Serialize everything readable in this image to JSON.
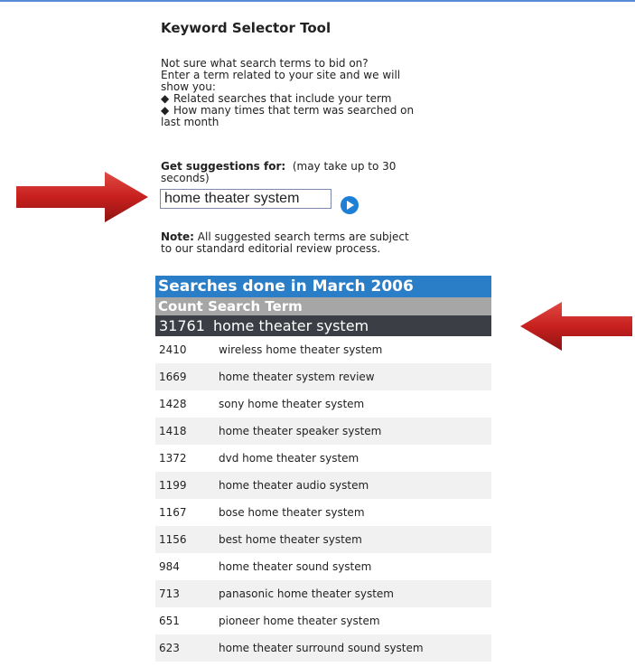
{
  "page": {
    "title": "Keyword Selector Tool",
    "intro_lines": [
      "Not sure what search terms to bid on?",
      "Enter a term related to your site and we will",
      "show you:"
    ],
    "bullets": [
      "Related searches that include your term",
      "How many times that term was searched on"
    ],
    "intro_tail": "last month",
    "suggest_label": "Get suggestions for:",
    "suggest_hint_1": "(may take up to 30",
    "suggest_hint_2": "seconds)",
    "search_value": "home theater system",
    "note_label": "Note:",
    "note_line_1": "All suggested search terms are subject",
    "note_line_2": "to our standard editorial review process."
  },
  "results": {
    "header": "Searches done in March 2006",
    "col_header": "Count Search Term",
    "top": {
      "count": "31761",
      "term": "home theater system"
    },
    "rows": [
      {
        "count": "2410",
        "term": "wireless home theater system"
      },
      {
        "count": "1669",
        "term": "home theater system review"
      },
      {
        "count": "1428",
        "term": "sony home theater system"
      },
      {
        "count": "1418",
        "term": "home theater speaker system"
      },
      {
        "count": "1372",
        "term": "dvd home theater system"
      },
      {
        "count": "1199",
        "term": "home theater audio system"
      },
      {
        "count": "1167",
        "term": "bose home theater system"
      },
      {
        "count": "1156",
        "term": "best home theater system"
      },
      {
        "count": "984",
        "term": "home theater sound system"
      },
      {
        "count": "713",
        "term": "panasonic home theater system"
      },
      {
        "count": "651",
        "term": "pioneer home theater system"
      },
      {
        "count": "623",
        "term": "home theater surround sound system"
      }
    ]
  },
  "colors": {
    "header_blue": "#2a7ec8",
    "col_header_gray": "#a6a6a6",
    "top_row_dark": "#3b3f45",
    "arrow_red": "#c8201e"
  },
  "icons": [
    "right-arrow-icon",
    "left-arrow-icon",
    "go-icon"
  ]
}
